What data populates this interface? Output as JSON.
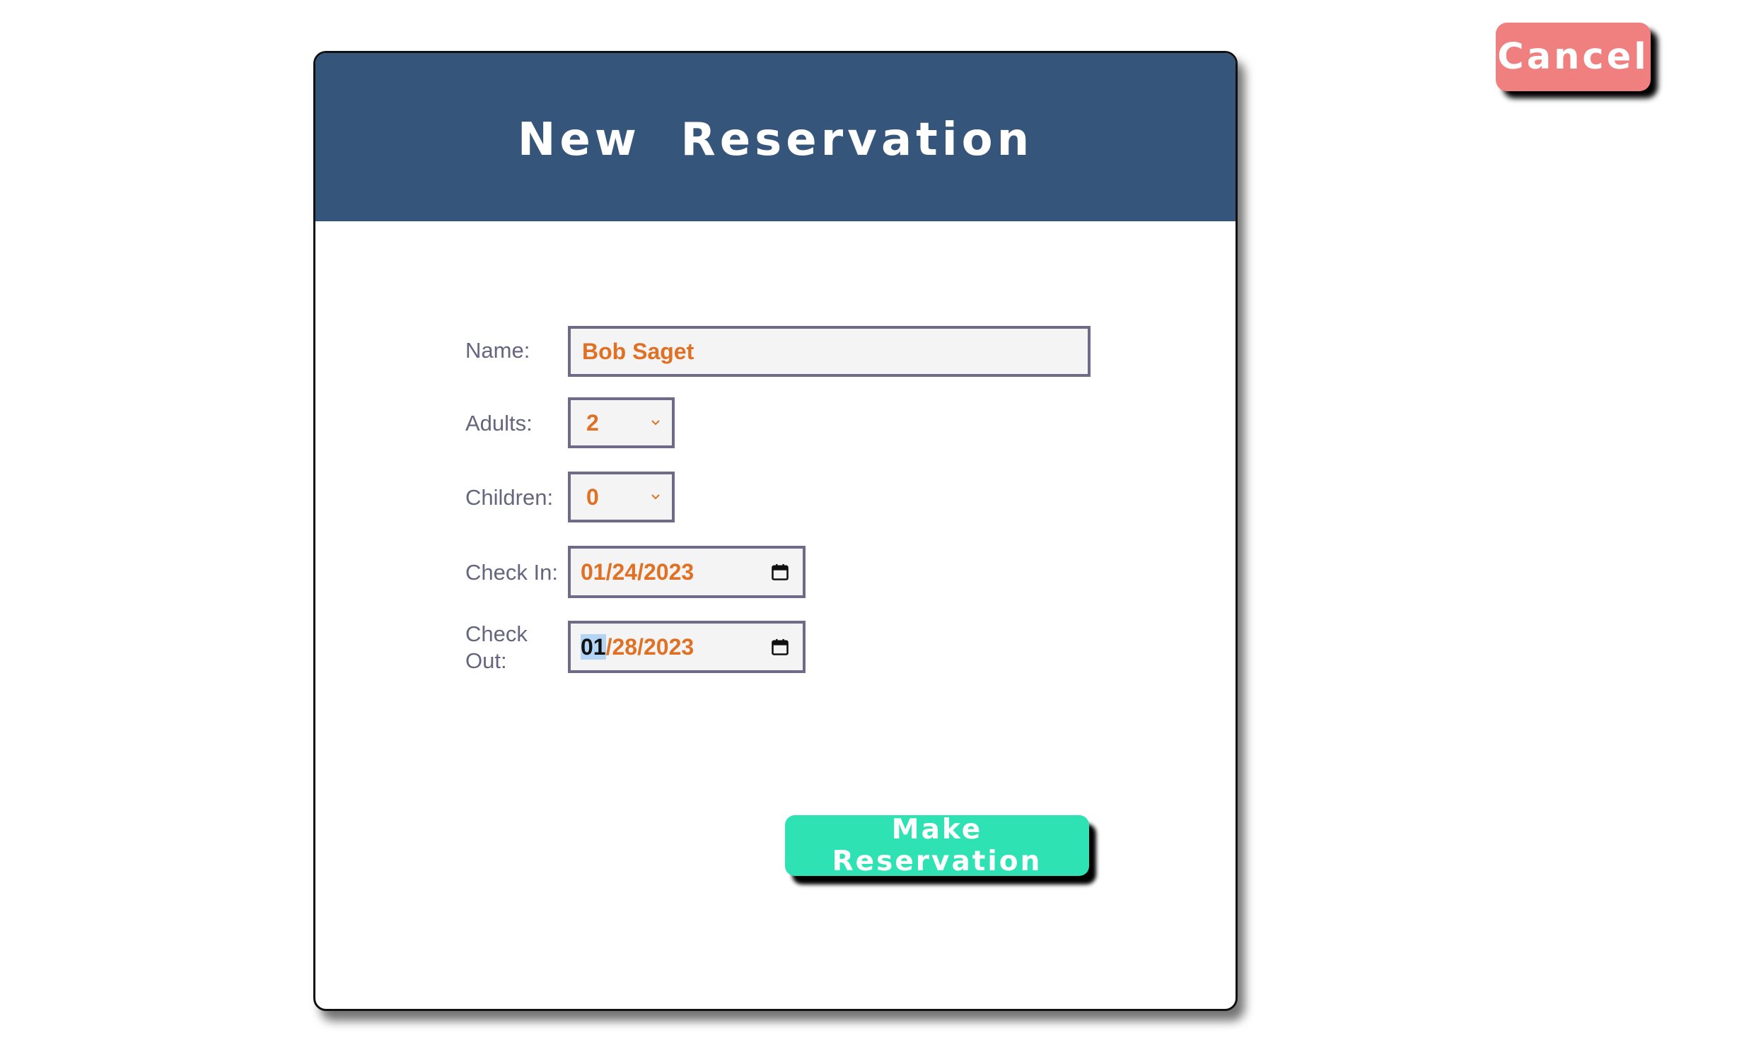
{
  "header": {
    "cancel_label": "Cancel"
  },
  "card": {
    "title": "New  Reservation",
    "submit_label": "Make Reservation"
  },
  "form": {
    "name": {
      "label": "Name:",
      "value": "Bob Saget"
    },
    "adults": {
      "label": "Adults:",
      "value": "2"
    },
    "children": {
      "label": "Children:",
      "value": "0"
    },
    "check_in": {
      "label": "Check In:",
      "value": "01/24/2023"
    },
    "check_out": {
      "label_line1": "Check",
      "label_line2": "Out:",
      "value_selected": "01",
      "value_rest": "/28/2023"
    }
  },
  "icons": {
    "select_chevron": "chevron-down-icon",
    "date_picker": "calendar-icon"
  },
  "colors": {
    "header_bg": "#35557a",
    "cancel_bg": "#f07f80",
    "submit_bg": "#2ee2b4",
    "field_text": "#e07124",
    "label_text": "#65657f",
    "field_border": "#6e6a88"
  }
}
